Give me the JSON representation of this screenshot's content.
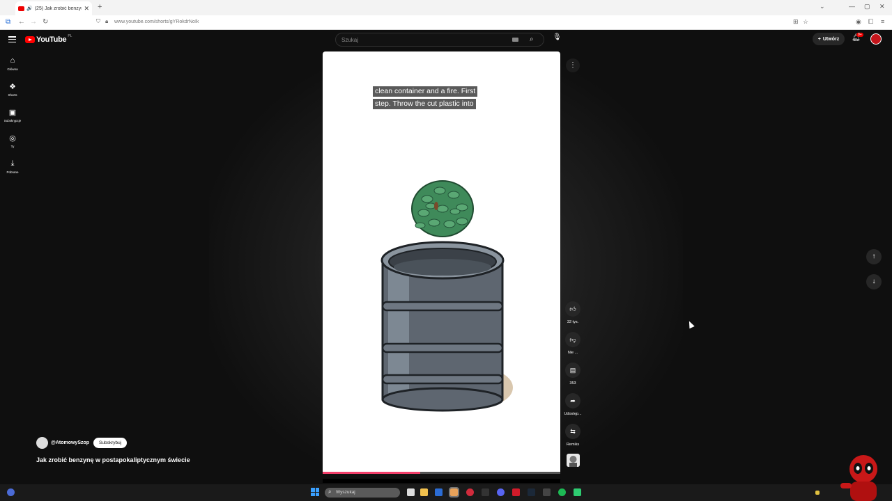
{
  "browser": {
    "tab_title": "(25) Jak zrobić benzynę w p",
    "tab_close": "✕",
    "new_tab": "+",
    "url": "www.youtube.com/shorts/gYRokdrNoIk",
    "min": "—",
    "max": "▢",
    "close": "✕"
  },
  "youtube": {
    "logo_text": "YouTube",
    "country_code": "PL",
    "search_placeholder": "Szukaj",
    "create_label": "Utwórz",
    "notification_count": "9+"
  },
  "sidebar": {
    "items": [
      {
        "label": "Główna",
        "icon": "home-icon"
      },
      {
        "label": "Shorts",
        "icon": "shorts-icon"
      },
      {
        "label": "Subskrypcje",
        "icon": "subscriptions-icon"
      },
      {
        "label": "Ty",
        "icon": "user-icon"
      },
      {
        "label": "Pobrane",
        "icon": "download-icon"
      }
    ]
  },
  "video": {
    "caption_line1": "clean container and a fire.  First",
    "caption_line2": "step.  Throw the cut plastic into",
    "progress": 0.41
  },
  "actions": {
    "like_count": "32 tys.",
    "dislike_label": "Nie ...",
    "comment_count": "353",
    "share_label": "Udostęp...",
    "remix_label": "Remiks"
  },
  "channel": {
    "handle": "@AtomowySzop",
    "subscribe_label": "Subskrybuj",
    "video_title": "Jak zrobić benzynę w postapokaliptycznym świecie"
  },
  "taskbar": {
    "search_placeholder": "Wyszukaj"
  },
  "colors": {
    "accent": "#ff0000",
    "progress": "#f23f6a",
    "background": "#0f0f0f"
  }
}
